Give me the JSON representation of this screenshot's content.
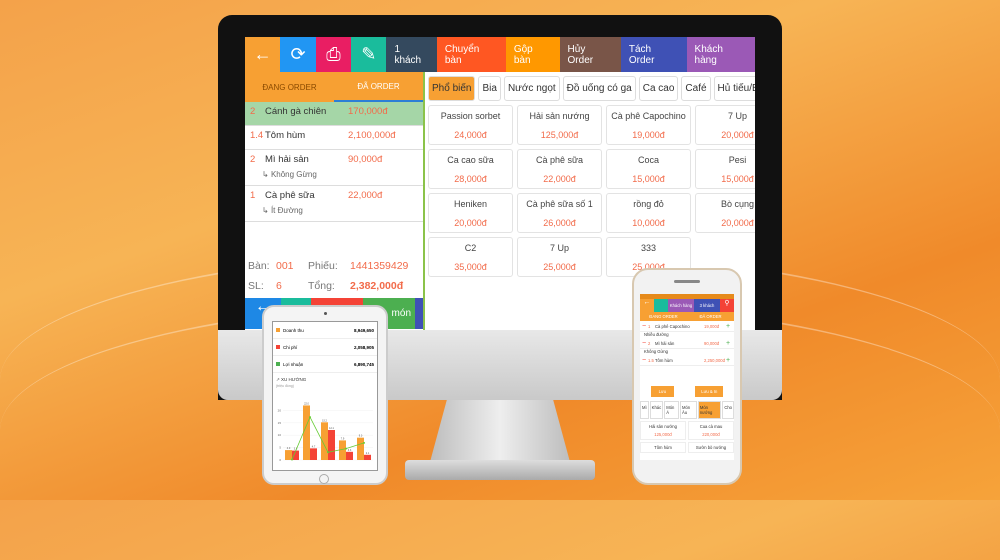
{
  "toolbar": {
    "items": [
      {
        "icon": "back-arrow-icon",
        "color": "#f7a033"
      },
      {
        "icon": "refresh-icon",
        "color": "#2196f3"
      },
      {
        "icon": "printer-icon",
        "color": "#e91e63"
      },
      {
        "icon": "notepad-icon",
        "color": "#1abc9c"
      },
      {
        "label": "1 khách",
        "color": "#34495e"
      },
      {
        "label": "Chuyển bàn",
        "color": "#ff5722"
      },
      {
        "label": "Gộp bàn",
        "color": "#ff9800"
      },
      {
        "label": "Hủy Order",
        "color": "#795548"
      },
      {
        "label": "Tách Order",
        "color": "#3f51b5"
      },
      {
        "label": "Khách hàng",
        "color": "#9b59b6"
      }
    ]
  },
  "order_tabs": {
    "current": "ĐANG ORDER",
    "done": "ĐÃ ORDER"
  },
  "order_items": [
    {
      "qty": "2",
      "name": "Cánh gà chiên",
      "price": "170,000đ",
      "selected": true
    },
    {
      "qty": "1.4",
      "name": "Tôm hùm",
      "price": "2,100,000đ"
    },
    {
      "qty": "2",
      "name": "Mì hải sản",
      "price": "90,000đ",
      "note": "Không Gừng"
    },
    {
      "qty": "1",
      "name": "Cà phê sữa",
      "price": "22,000đ",
      "note": "Ít Đường"
    }
  ],
  "summary": {
    "table_label": "Bàn:",
    "table": "001",
    "ticket_label": "Phiếu:",
    "ticket": "1441359429",
    "qty_label": "SL:",
    "qty": "6",
    "total_label": "Tổng:",
    "total": "2,382,000đ"
  },
  "bottom_bar": {
    "partial_label": "món"
  },
  "categories": [
    {
      "label": "Phổ biến",
      "active": true
    },
    {
      "label": "Bia"
    },
    {
      "label": "Nước ngọt"
    },
    {
      "label": "Đồ uống có ga"
    },
    {
      "label": "Ca cao"
    },
    {
      "label": "Café"
    },
    {
      "label": "Hủ tiếu/Bún"
    }
  ],
  "products": [
    {
      "name": "Passion sorbet",
      "price": "24,000đ"
    },
    {
      "name": "Hải sản nướng",
      "price": "125,000đ"
    },
    {
      "name": "Cà phê Capochino",
      "price": "19,000đ"
    },
    {
      "name": "7 Up",
      "price": "20,000đ"
    },
    {
      "name": "Ca cao sữa",
      "price": "28,000đ"
    },
    {
      "name": "Cà phê sữa",
      "price": "22,000đ"
    },
    {
      "name": "Coca",
      "price": "15,000đ"
    },
    {
      "name": "Pesi",
      "price": "15,000đ"
    },
    {
      "name": "Heniken",
      "price": "20,000đ"
    },
    {
      "name": "Cà phê sữa số 1",
      "price": "26,000đ"
    },
    {
      "name": "rồng đỏ",
      "price": "10,000đ"
    },
    {
      "name": "Bò cụng",
      "price": "20,000đ"
    },
    {
      "name": "C2",
      "price": "35,000đ"
    },
    {
      "name": "7 Up",
      "price": "25,000đ"
    },
    {
      "name": "333",
      "price": "25,000đ"
    }
  ],
  "tablet": {
    "stats": [
      {
        "label": "Doanh thu",
        "value": "8,949,650",
        "color": "#f7a033"
      },
      {
        "label": "Chi phí",
        "value": "2,058,905",
        "color": "#f44336"
      },
      {
        "label": "Lợi nhuận",
        "value": "6,890,745",
        "color": "#4caf50"
      }
    ],
    "chart_title": "XU HƯỚNG",
    "chart_unit": "(triệu đồng)"
  },
  "chart_data": {
    "type": "bar",
    "title": "XU HƯỚNG",
    "ylabel": "(triệu đồng)",
    "ylim": [
      0,
      25
    ],
    "yticks": [
      0,
      5,
      10,
      15,
      20
    ],
    "grid": true,
    "series": [
      {
        "values": [
          4.0,
          22.0,
          15.2,
          7.9,
          9.0
        ],
        "color": "#f7a033"
      },
      {
        "values": [
          3.8,
          4.7,
          12.1,
          3.3,
          2.1
        ],
        "color": "#f44336"
      },
      {
        "type": "line",
        "values": [
          0.2,
          17.3,
          3.1,
          4.6,
          6.9
        ],
        "color": "#66cc33"
      }
    ]
  },
  "phone": {
    "toolbar": [
      "Khách hàng",
      "3 khách"
    ],
    "tabs": [
      "ĐANG ORDER",
      "ĐÃ ORDER"
    ],
    "items": [
      {
        "qty": "1",
        "name": "Cà phê Capochino",
        "price": "19,000đ",
        "note": "Nhiều đường"
      },
      {
        "qty": "2",
        "name": "Mì hải sản",
        "price": "90,000đ",
        "note": "Không Gừng"
      },
      {
        "qty": "1.5",
        "name": "Tôm hùm",
        "price": "2,250,000đ"
      }
    ],
    "save": "Lưu",
    "save_print": "Lưu & In",
    "categories": [
      "Mì",
      "Khác",
      "Món Á",
      "Món Âu",
      "Món nướng",
      "Cho"
    ],
    "products": [
      {
        "name": "Hải sản nướng",
        "price": "125,000đ"
      },
      {
        "name": "Cua cà mau",
        "price": "220,000đ"
      },
      {
        "name": "Tôm hùm"
      },
      {
        "name": "Sườn bò nướng"
      }
    ]
  }
}
